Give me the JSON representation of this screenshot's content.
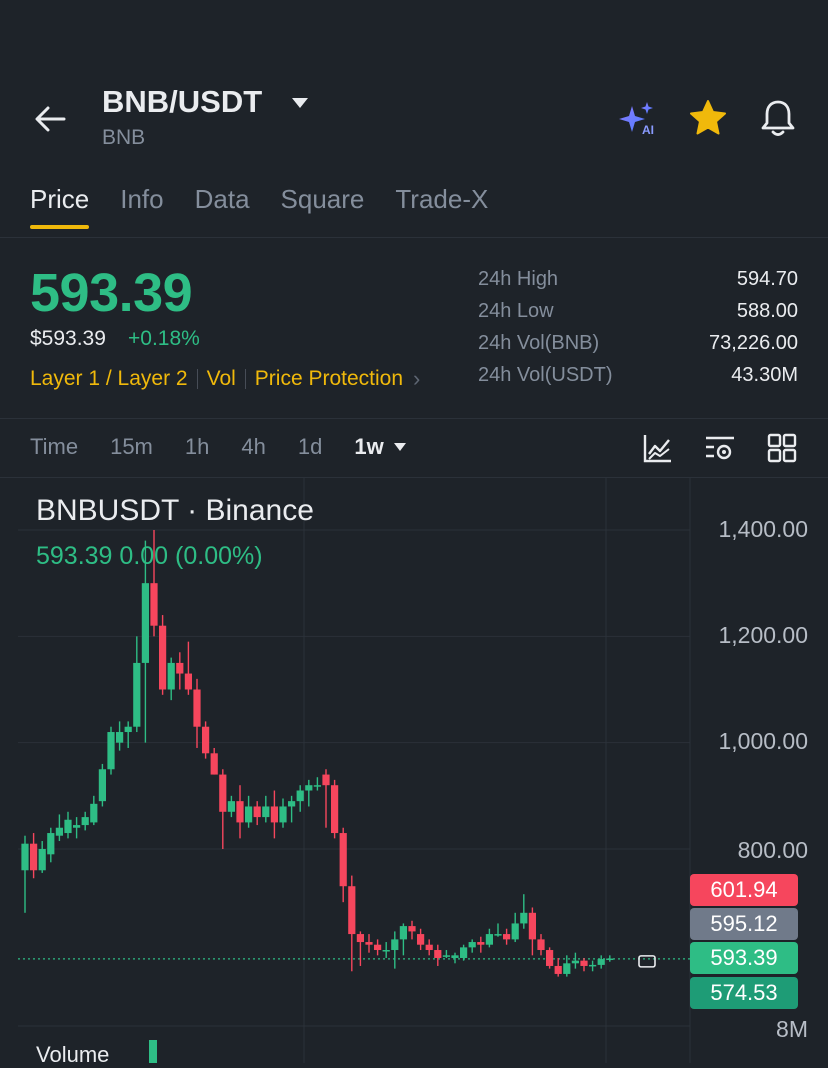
{
  "header": {
    "pair": "BNB/USDT",
    "base": "BNB",
    "ai_label": "AI"
  },
  "tabs": [
    "Price",
    "Info",
    "Data",
    "Square",
    "Trade-X"
  ],
  "ticker": {
    "last_price": "593.39",
    "usd_price": "$593.39",
    "change_pct": "+0.18%",
    "tags": [
      "Layer 1 / Layer 2",
      "Vol",
      "Price Protection"
    ],
    "stats": [
      {
        "label": "24h High",
        "value": "594.70"
      },
      {
        "label": "24h Low",
        "value": "588.00"
      },
      {
        "label": "24h Vol(BNB)",
        "value": "73,226.00"
      },
      {
        "label": "24h Vol(USDT)",
        "value": "43.30M"
      }
    ]
  },
  "intervals": [
    "Time",
    "15m",
    "1h",
    "4h",
    "1d",
    "1w"
  ],
  "chart": {
    "title": "BNBUSDT · Binance",
    "ohlc_line": "593.39  0.00 (0.00%)",
    "volume_label": "Volume",
    "y_ticks": [
      "1,400.00",
      "1,200.00",
      "1,000.00",
      "800.00"
    ],
    "volume_tick": "8M",
    "price_tags": [
      {
        "value": "601.94",
        "color": "#f6465d"
      },
      {
        "value": "595.12",
        "color": "#707a8a"
      },
      {
        "value": "593.39",
        "color": "#2ebd85"
      },
      {
        "value": "574.53",
        "color": "#1e9c76"
      }
    ]
  },
  "chart_data": {
    "type": "candlestick",
    "ylim": [
      560,
      1430
    ],
    "up_color": "#2ebd85",
    "down_color": "#f6465d",
    "candles": [
      [
        760,
        810,
        825,
        680
      ],
      [
        810,
        760,
        830,
        745
      ],
      [
        760,
        800,
        815,
        755
      ],
      [
        790,
        830,
        840,
        775
      ],
      [
        825,
        840,
        865,
        815
      ],
      [
        830,
        855,
        870,
        820
      ],
      [
        840,
        845,
        860,
        820
      ],
      [
        845,
        860,
        870,
        835
      ],
      [
        850,
        885,
        900,
        845
      ],
      [
        890,
        950,
        960,
        880
      ],
      [
        950,
        1020,
        1030,
        940
      ],
      [
        1000,
        1020,
        1040,
        985
      ],
      [
        1020,
        1030,
        1040,
        990
      ],
      [
        1030,
        1150,
        1200,
        1020
      ],
      [
        1150,
        1300,
        1380,
        1000
      ],
      [
        1300,
        1220,
        1400,
        1200
      ],
      [
        1220,
        1100,
        1240,
        1090
      ],
      [
        1100,
        1150,
        1160,
        1080
      ],
      [
        1150,
        1130,
        1170,
        1100
      ],
      [
        1130,
        1100,
        1190,
        1090
      ],
      [
        1100,
        1030,
        1120,
        990
      ],
      [
        1030,
        980,
        1040,
        970
      ],
      [
        980,
        940,
        990,
        940
      ],
      [
        940,
        870,
        950,
        800
      ],
      [
        870,
        890,
        900,
        860
      ],
      [
        890,
        850,
        920,
        820
      ],
      [
        850,
        880,
        900,
        840
      ],
      [
        880,
        860,
        890,
        845
      ],
      [
        860,
        880,
        900,
        850
      ],
      [
        880,
        850,
        910,
        820
      ],
      [
        850,
        880,
        895,
        840
      ],
      [
        880,
        890,
        900,
        850
      ],
      [
        890,
        910,
        920,
        870
      ],
      [
        910,
        920,
        930,
        880
      ],
      [
        920,
        920,
        935,
        910
      ],
      [
        940,
        920,
        950,
        840
      ],
      [
        920,
        830,
        930,
        820
      ],
      [
        830,
        730,
        840,
        700
      ],
      [
        730,
        640,
        750,
        570
      ],
      [
        640,
        625,
        645,
        580
      ],
      [
        625,
        620,
        640,
        605
      ],
      [
        620,
        610,
        630,
        600
      ],
      [
        610,
        610,
        625,
        595
      ],
      [
        610,
        630,
        645,
        575
      ],
      [
        630,
        655,
        660,
        600
      ],
      [
        655,
        645,
        665,
        630
      ],
      [
        640,
        620,
        650,
        610
      ],
      [
        620,
        610,
        630,
        600
      ],
      [
        610,
        595,
        620,
        580
      ],
      [
        600,
        600,
        610,
        595
      ],
      [
        595,
        600,
        605,
        585
      ],
      [
        595,
        615,
        620,
        590
      ],
      [
        615,
        625,
        630,
        605
      ],
      [
        625,
        620,
        635,
        605
      ],
      [
        620,
        640,
        650,
        615
      ],
      [
        640,
        640,
        660,
        635
      ],
      [
        640,
        630,
        650,
        620
      ],
      [
        630,
        660,
        680,
        625
      ],
      [
        660,
        680,
        715,
        650
      ],
      [
        680,
        630,
        690,
        600
      ],
      [
        630,
        610,
        640,
        600
      ],
      [
        610,
        580,
        615,
        575
      ],
      [
        580,
        565,
        595,
        560
      ],
      [
        565,
        585,
        600,
        560
      ],
      [
        585,
        590,
        605,
        575
      ],
      [
        590,
        580,
        595,
        570
      ],
      [
        580,
        582,
        590,
        570
      ],
      [
        582,
        593,
        600,
        575
      ],
      [
        593,
        594,
        600,
        588
      ]
    ]
  }
}
